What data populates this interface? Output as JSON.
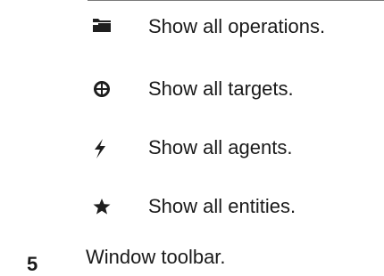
{
  "legend": {
    "items": [
      {
        "icon": "folder-icon",
        "label": "Show all operations."
      },
      {
        "icon": "crosshair-icon",
        "label": "Show all targets."
      },
      {
        "icon": "lightning-icon",
        "label": "Show all agents."
      },
      {
        "icon": "star-icon",
        "label": "Show all entities."
      }
    ]
  },
  "step": {
    "number": "5",
    "text": "Window toolbar."
  },
  "colors": {
    "icon": "#1f1f1f",
    "text": "#1a1a1a",
    "rule": "#7a7a7a"
  }
}
